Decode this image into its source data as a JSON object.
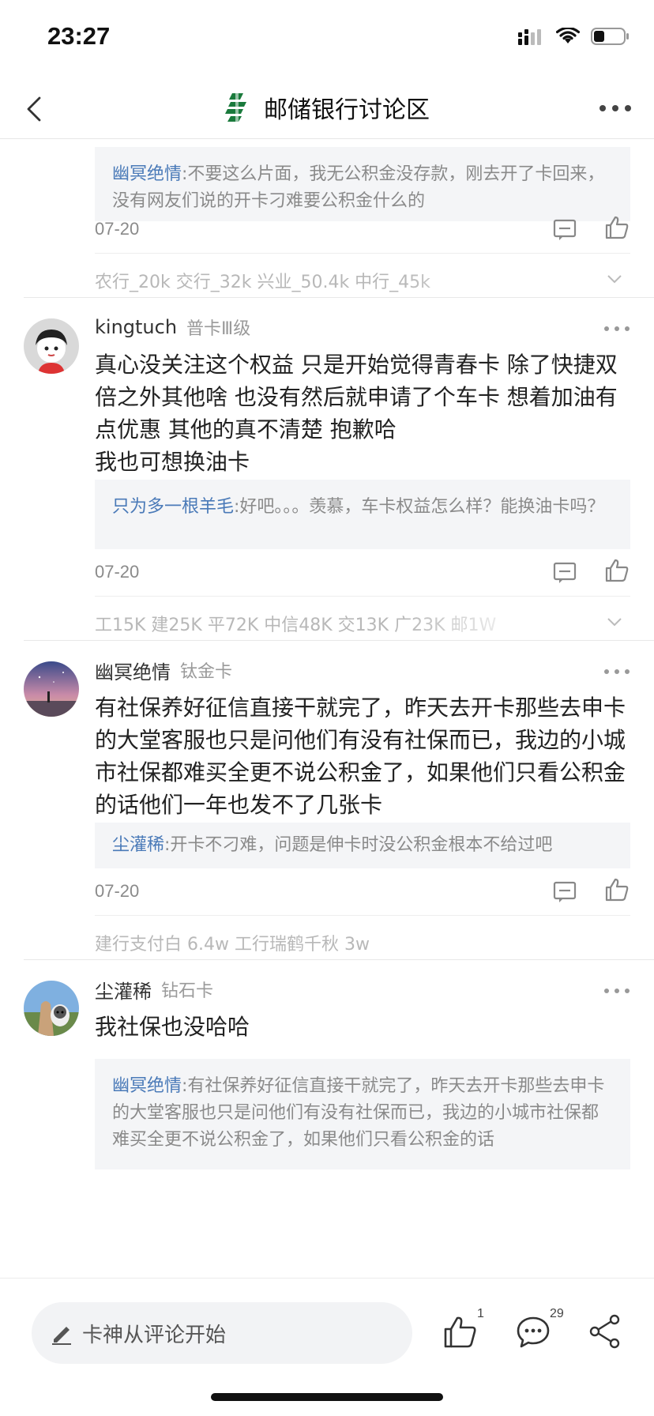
{
  "status_bar": {
    "time": "23:27"
  },
  "nav": {
    "title": "邮储银行讨论区"
  },
  "post0": {
    "quote_name": "幽冥绝情",
    "quote_text": ":不要这么片面，我无公积金没存款，刚去开了卡回来，没有网友们说的开卡刁难要公积金什么的",
    "date": "07-20",
    "signature": "农行_20k    交行_32k    兴业_50.4k    中行_45k"
  },
  "post1": {
    "username": "kingtuch",
    "badge": "普卡Ⅲ级",
    "body_line1": "真心没关注这个权益 只是开始觉得青春卡 除了快捷双倍之外其他啥 也没有然后就申请了个车卡 想着加油有点优惠 其他的真不清楚 抱歉哈",
    "body_line2": "我也可想换油卡",
    "quote_name": "只为多一根羊毛",
    "quote_text": ":好吧。。。羡慕，车卡权益怎么样？能换油卡吗？",
    "date": "07-20",
    "signature": "工15K 建25K 平72K 中信48K 交13K 广23K 邮1W"
  },
  "post2": {
    "username": "幽冥绝情",
    "badge": "钛金卡",
    "body": "有社保养好征信直接干就完了，昨天去开卡那些去申卡的大堂客服也只是问他们有没有社保而已，我边的小城市社保都难买全更不说公积金了，如果他们只看公积金的话他们一年也发不了几张卡",
    "quote_name": "尘灌稀",
    "quote_text": ":开卡不刁难，问题是伸卡时没公积金根本不给过吧",
    "date": "07-20",
    "signature": "建行支付白 6.4w   工行瑞鹤千秋 3w"
  },
  "post3": {
    "username": "尘灌稀",
    "badge": "钻石卡",
    "body": "我社保也没哈哈",
    "quote_name": "幽冥绝情",
    "quote_text": ":有社保养好征信直接干就完了，昨天去开卡那些去申卡的大堂客服也只是问他们有没有社保而已，我边的小城市社保都难买全更不说公积金了，如果他们只看公积金的话"
  },
  "bottom_bar": {
    "input_placeholder": "卡神从评论开始",
    "like_count": "1",
    "comment_count": "29"
  },
  "colors": {
    "accent_link": "#4a7ab8",
    "brand_green": "#1a7a3c"
  }
}
